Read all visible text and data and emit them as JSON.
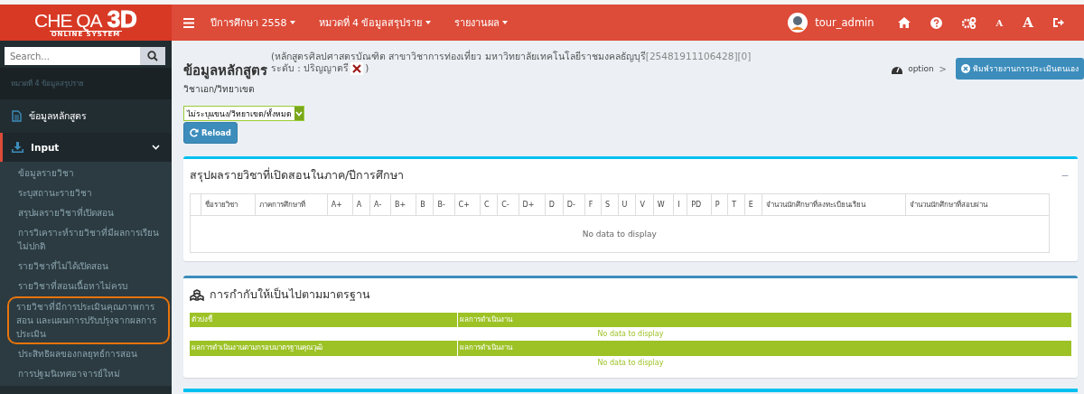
{
  "header": {
    "logo": {
      "main": "CHE QA",
      "accent": "3D",
      "sub": "ONLINE SYSTEM"
    },
    "menus": [
      {
        "label": "ปีการศึกษา 2558"
      },
      {
        "label": "หมวดที่ 4 ข้อมูลสรุปราย"
      },
      {
        "label": "รายงานผล"
      }
    ],
    "user": "tour_admin",
    "font_small": "A",
    "font_large": "A"
  },
  "sidebar": {
    "search": {
      "placeholder": "Search..."
    },
    "section": "หมวดที่ 4 ข้อมูลสรุปราย",
    "items": [
      {
        "label": "ข้อมูลหลักสูตร",
        "kind": "link",
        "expanded": false
      },
      {
        "label": "Input",
        "kind": "group",
        "expanded": true
      }
    ],
    "subitems": [
      {
        "label": "ข้อมูลรายวิชา",
        "highlighted": false
      },
      {
        "label": "ระบุสถานะรายวิชา",
        "highlighted": false
      },
      {
        "label": "สรุปผลรายวิชาที่เปิดสอน",
        "highlighted": false
      },
      {
        "label": "การวิเคราะห์รายวิชาที่มีผลการเรียนไม่ปกติ",
        "highlighted": false
      },
      {
        "label": "รายวิชาที่ไม่ได้เปิดสอน",
        "highlighted": false
      },
      {
        "label": "รายวิชาที่สอนเนื้อหาไม่ครบ",
        "highlighted": false
      },
      {
        "label": "รายวิชาที่มีการประเมินคุณภาพการสอน และแผนการปรับปรุงจากผลการประเมิน",
        "highlighted": true
      },
      {
        "label": "ประสิทธิผลของกลยุทธ์การสอน",
        "highlighted": false
      },
      {
        "label": "การปฐมนิเทศอาจารย์ใหม่",
        "highlighted": false
      }
    ]
  },
  "page": {
    "title": "ข้อมูลหลักสูตร",
    "subtitle_line1": "(หลักสูตรศิลปศาสตรบัณฑิต สาขาวิชาการท่องเที่ยว มหาวิทยาลัยเทคโนโลยีราชมงคลธัญบุรี",
    "code": "[25481911106428][0]",
    "subtitle_line2": "ระดับ : ปริญญาตรี",
    "close_paren": ")",
    "major_label": "วิชาเอก/วิทยาเขต",
    "select_value": "ไม่ระบุแขนง/วิทยาเขต/ทั้งหมด",
    "reload": "Reload",
    "breadcrumb": "option",
    "breadcrumb_sep": ">",
    "print_button": "พิมพ์รายงานการประเมินตนเอง"
  },
  "summary_panel": {
    "title": "สรุปผลรายวิชาที่เปิดสอนในภาค/ปีการศึกษา",
    "collapse": "−",
    "columns": [
      "",
      "ชื่อรายวิชา",
      "ภาคการศึกษาที่",
      "A+",
      "A",
      "A-",
      "B+",
      "B",
      "B-",
      "C+",
      "C",
      "C-",
      "D+",
      "D",
      "D-",
      "F",
      "S",
      "U",
      "V",
      "W",
      "I",
      "PD",
      "P",
      "T",
      "E",
      "จำนวนนักศึกษาที่ลงทะเบียนเรียน",
      "จำนวนนักศึกษาที่สอบผ่าน"
    ],
    "empty": "No data to display"
  },
  "standards_panel": {
    "title": "การกำกับให้เป็นไปตามมาตรฐาน",
    "tables": [
      {
        "columns": [
          "ตัวบ่งชี้",
          "ผลการดำเนินงาน"
        ],
        "empty": "No data to display"
      },
      {
        "columns": [
          "ผลการดำเนินงานตามกรอบมาตรฐานคุณวุฒิ",
          "ผลการดำเนินงาน"
        ],
        "empty": "No data to display"
      }
    ]
  }
}
